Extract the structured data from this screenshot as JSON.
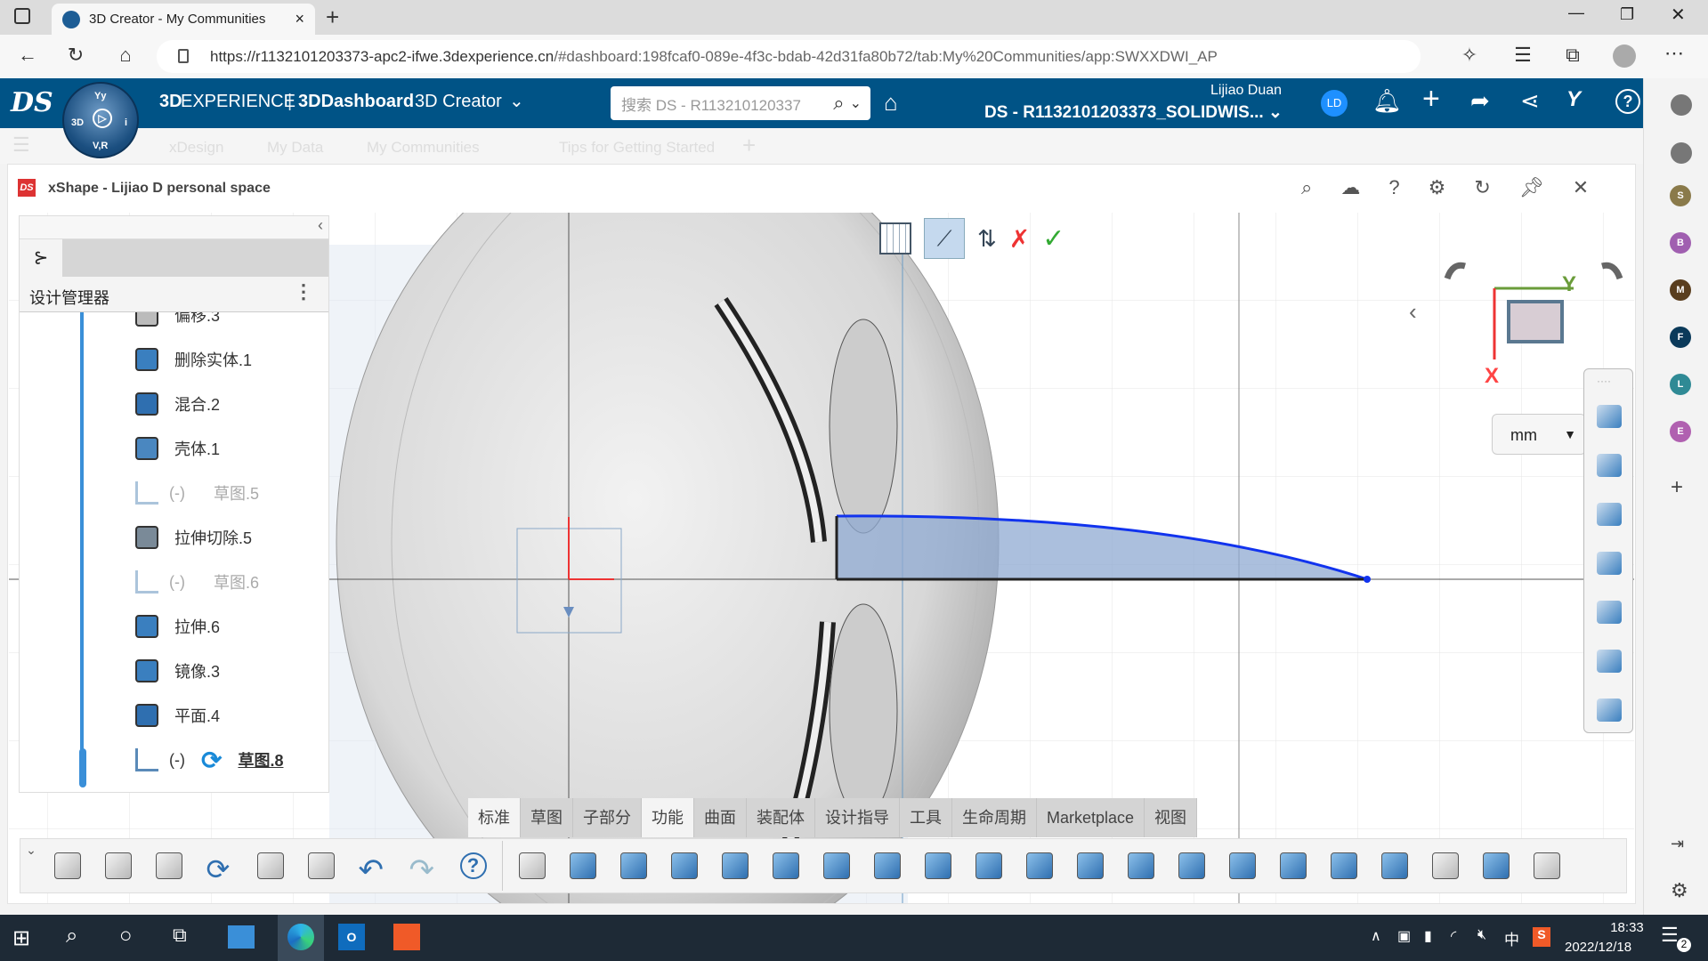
{
  "browser": {
    "tab_title": "3D Creator - My Communities",
    "url_host": "https://r1132101203373-apc2-ifwe.3dexperience.cn",
    "url_rest": "/#dashboard:198fcaf0-089e-4f3c-bdab-42d31fa80b72/tab:My%20Communities/app:SWXXDWI_AP"
  },
  "header": {
    "brand_bold": "3D",
    "brand_rest": "EXPERIENCE",
    "dashboard": "3DDashboard",
    "app": "3D Creator",
    "search_placeholder": "搜索 DS - R113210120337",
    "user_name": "Lijiao Duan",
    "tenant": "DS - R1132101203373_SOLIDWIS...",
    "user_initials": "LD",
    "compass": {
      "top": "Yy",
      "left": "3D",
      "right": "i",
      "bottom": "V,R"
    },
    "accent": "#005386"
  },
  "dashboard_tabs": [
    "xDesign",
    "My Data",
    "My Communities",
    "Tips for Getting Started"
  ],
  "app": {
    "title": "xShape - Lijiao D personal space",
    "panel_title": "设计管理器",
    "tree": [
      {
        "label": "偏移.3",
        "icon": "offset-icon",
        "state": "normal"
      },
      {
        "label": "删除实体.1",
        "icon": "delete-body-icon",
        "state": "normal"
      },
      {
        "label": "混合.2",
        "icon": "combine-icon",
        "state": "normal"
      },
      {
        "label": "壳体.1",
        "icon": "shell-icon",
        "state": "normal"
      },
      {
        "label": "草图.5",
        "prefix": "(-)",
        "icon": "sketch-icon",
        "state": "hidden"
      },
      {
        "label": "拉伸切除.5",
        "icon": "extrude-cut-icon",
        "state": "normal"
      },
      {
        "label": "草图.6",
        "prefix": "(-)",
        "icon": "sketch-icon",
        "state": "hidden"
      },
      {
        "label": "拉伸.6",
        "icon": "extrude-icon",
        "state": "normal"
      },
      {
        "label": "镜像.3",
        "icon": "mirror-icon",
        "state": "normal"
      },
      {
        "label": "平面.4",
        "icon": "plane-icon",
        "state": "normal"
      },
      {
        "label": "草图.8",
        "prefix": "(-)",
        "icon": "sketch-icon",
        "state": "editing"
      }
    ],
    "command_tabs": [
      "标准",
      "草图",
      "子部分",
      "功能",
      "曲面",
      "装配体",
      "设计指导",
      "工具",
      "生命周期",
      "Marketplace",
      "视图"
    ],
    "active_command_tab": "功能",
    "toolbar_icons": [
      "new-icon",
      "open-icon",
      "save-icon",
      "refresh-icon",
      "properties-icon",
      "settings-icon",
      "undo-icon",
      "redo-icon",
      "help-icon",
      "primitive-icon",
      "extrude-icon",
      "extrude-cut-icon",
      "revolve-icon",
      "sweep-icon",
      "loft-icon",
      "fillet-icon",
      "hole-icon",
      "chamfer-icon",
      "shell-icon",
      "move-face-icon",
      "mirror-icon",
      "pattern-icon",
      "rib-icon",
      "draft-icon",
      "combine-icon",
      "split-icon",
      "delete-body-icon",
      "transform-icon",
      "scale-icon",
      "thicken-icon"
    ],
    "units": "mm",
    "axis_x": "X",
    "axis_y": "Y",
    "view_tools": [
      "print-icon",
      "lock-rotate-icon",
      "select-icon",
      "add-select-icon",
      "zoom-fit-icon",
      "normal-to-icon",
      "exit-icon"
    ]
  },
  "right_sidebar": {
    "avatars": [
      {
        "letter": "S",
        "color": "#8a7a4a"
      },
      {
        "letter": "B",
        "color": "#a05fb0"
      },
      {
        "letter": "M",
        "color": "#5a3e1e"
      },
      {
        "letter": "F",
        "color": "#0b3a5a"
      },
      {
        "letter": "L",
        "color": "#2f8a95"
      },
      {
        "letter": "E",
        "color": "#b060b0"
      }
    ]
  },
  "taskbar": {
    "time": "18:33",
    "date": "2022/12/18",
    "ime": "中",
    "notifications": "2"
  }
}
